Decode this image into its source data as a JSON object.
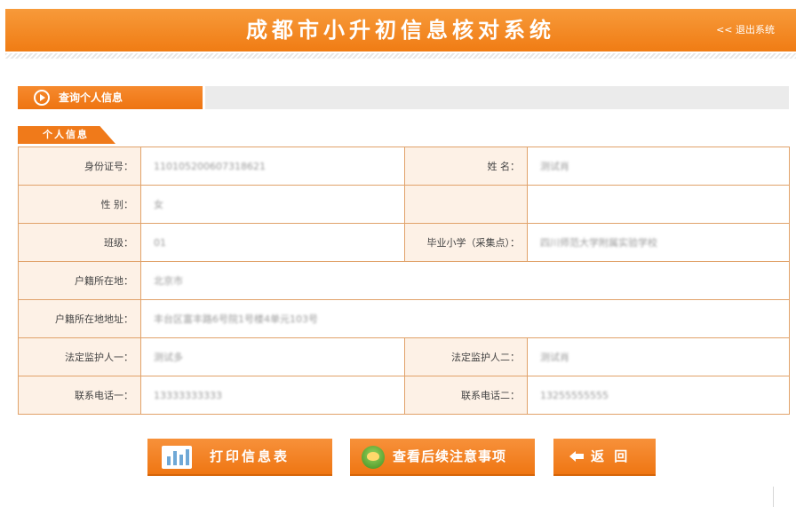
{
  "header": {
    "title": "成都市小升初信息核对系统",
    "logout": "<< 退出系统"
  },
  "section": {
    "title": "查询个人信息"
  },
  "sub_section": {
    "title": "个人信息"
  },
  "fields": {
    "id_card": {
      "label": "身份证号：",
      "value": "110105200607318621"
    },
    "name": {
      "label": "姓 名：",
      "value": "测试肖"
    },
    "gender": {
      "label": "性 别：",
      "value": "女"
    },
    "class": {
      "label": "班级：",
      "value": "01"
    },
    "school": {
      "label": "毕业小学（采集点）：",
      "value": "四川师范大学附属实验学校"
    },
    "hukou": {
      "label": "户籍所在地：",
      "value": "北京市"
    },
    "hukou_addr": {
      "label": "户籍所在地地址：",
      "value": "丰台区富丰路6号院1号楼4单元103号"
    },
    "guardian1": {
      "label": "法定监护人一：",
      "value": "测试多"
    },
    "guardian2": {
      "label": "法定监护人二：",
      "value": "测试肖"
    },
    "phone1": {
      "label": "联系电话一：",
      "value": "13333333333"
    },
    "phone2": {
      "label": "联系电话二：",
      "value": "13255555555"
    }
  },
  "buttons": {
    "print": "打印信息表",
    "notes": "查看后续注意事项",
    "back": "返 回"
  },
  "icons": {
    "section": "play-circle-icon",
    "print": "printer-icon",
    "notes": "notes-icon",
    "back": "arrow-left-icon"
  },
  "colors": {
    "accent": "#f07c14",
    "label_bg": "#fdf1e6",
    "border": "#e1a26a"
  }
}
